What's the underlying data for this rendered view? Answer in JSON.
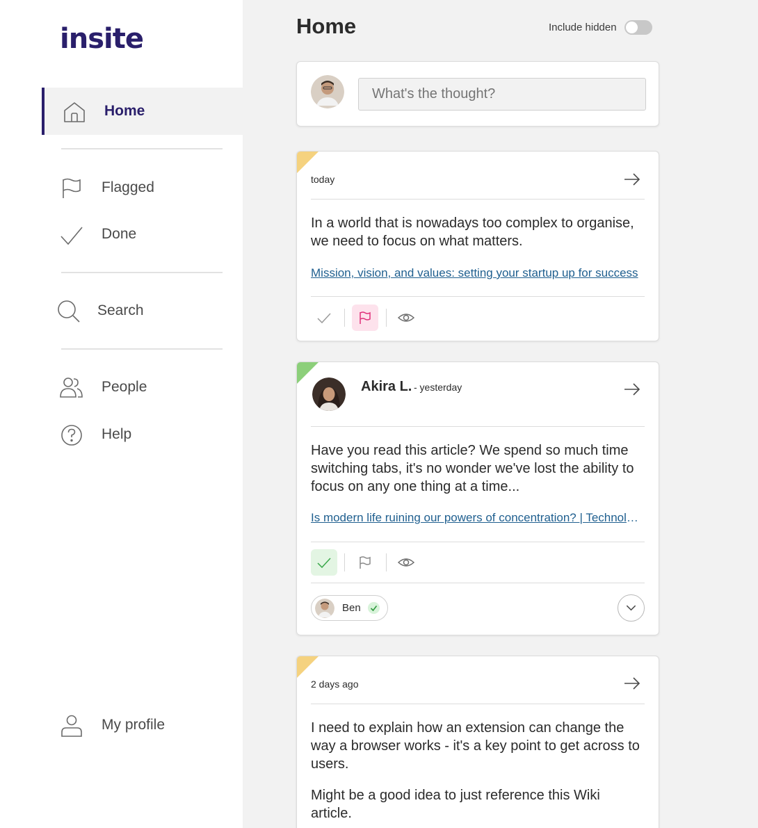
{
  "app": {
    "logo_text": "insite",
    "brand_color": "#2a1f6b",
    "accent_color": "#e0307a"
  },
  "sidebar": {
    "items": [
      {
        "label": "Home",
        "icon": "home-icon",
        "active": true
      },
      {
        "label": "Flagged",
        "icon": "flag-icon"
      },
      {
        "label": "Done",
        "icon": "check-icon"
      },
      {
        "label": "Search",
        "icon": "search-icon"
      },
      {
        "label": "People",
        "icon": "people-icon"
      },
      {
        "label": "Help",
        "icon": "help-icon"
      },
      {
        "label": "My profile",
        "icon": "user-icon"
      }
    ]
  },
  "header": {
    "title": "Home",
    "include_hidden_label": "Include hidden",
    "include_hidden_on": false
  },
  "composer": {
    "placeholder": "What's the thought?"
  },
  "cards": [
    {
      "corner_color": "#f5d27f",
      "time": "today",
      "text": "In a world that is nowadays too complex to organise, we need to focus on what matters.",
      "link": "Mission, vision, and values: setting your startup up for success",
      "done": false,
      "flagged": true
    },
    {
      "corner_color": "#8ccf7a",
      "author": "Akira L.",
      "time": "- yesterday",
      "text": "Have you read this article? We spend so much time switching tabs, it's no wonder we've lost the ability to focus on any one thing at a time...",
      "link": "Is modern life ruining our powers of concentration? | Technology",
      "done": true,
      "flagged": false,
      "shared_with": {
        "name": "Ben",
        "done": true
      }
    },
    {
      "corner_color": "#f5d27f",
      "time": "2 days ago",
      "text": "I need to explain how an extension can change the way a browser works - it's a key point to get across to users.",
      "text2": "Might be a good idea to just reference this Wiki article."
    }
  ]
}
